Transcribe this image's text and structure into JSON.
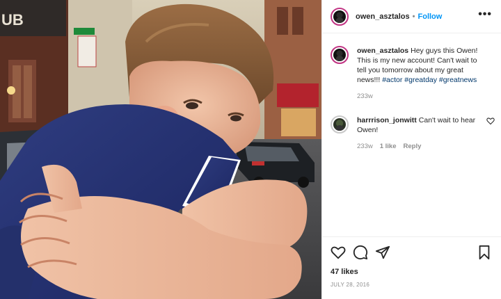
{
  "photo": {
    "description_icon": "photo-of-child-hugging",
    "storefront_sign": "UB"
  },
  "header": {
    "username": "owen_asztalos",
    "separator": "•",
    "follow_label": "Follow",
    "more_icon": "more-dots-icon",
    "more_label": "•••"
  },
  "caption": {
    "username": "owen_asztalos",
    "text": "Hey guys this Owen! This is my new account! Can't wait to tell you tomorrow about my great news!!! ",
    "hashtags": [
      "#actor",
      "#greatday",
      "#greatnews"
    ],
    "time": "233w"
  },
  "comments": [
    {
      "username": "harrrison_jonwitt",
      "text": "Can't wait to hear Owen!",
      "time": "233w",
      "likes": "1 like",
      "reply_label": "Reply"
    }
  ],
  "actions": {
    "like_icon": "heart-icon",
    "comment_icon": "comment-icon",
    "share_icon": "share-icon",
    "save_icon": "bookmark-icon",
    "likes_text": "47 likes",
    "date": "JULY 28, 2016"
  }
}
